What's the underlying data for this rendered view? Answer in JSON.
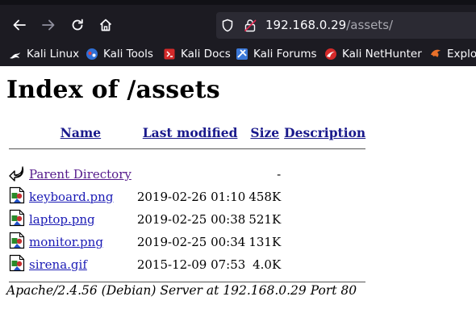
{
  "browser": {
    "url_host": "192.168.0.29",
    "url_path": "/assets/",
    "bookmarks": [
      {
        "label": "Kali Linux",
        "icon": "kali-dragon-icon"
      },
      {
        "label": "Kali Tools",
        "icon": "kali-tools-icon"
      },
      {
        "label": "Kali Docs",
        "icon": "kali-docs-icon"
      },
      {
        "label": "Kali Forums",
        "icon": "kali-forums-icon"
      },
      {
        "label": "Kali NetHunter",
        "icon": "kali-nethunter-icon"
      },
      {
        "label": "Exploit",
        "icon": "exploit-db-icon"
      }
    ]
  },
  "page": {
    "title": "Index of /assets",
    "columns": {
      "name": "Name",
      "last_modified": "Last modified",
      "size": "Size",
      "description": "Description"
    },
    "parent": {
      "name": "Parent Directory",
      "size": "-",
      "icon": "back-arrow-icon"
    },
    "files": [
      {
        "name": "keyboard.png",
        "modified": "2019-02-26 01:10",
        "size": "458K",
        "icon": "image-file-icon"
      },
      {
        "name": "laptop.png",
        "modified": "2019-02-25 00:38",
        "size": "521K",
        "icon": "image-file-icon"
      },
      {
        "name": "monitor.png",
        "modified": "2019-02-25 00:34",
        "size": "131K",
        "icon": "image-file-icon"
      },
      {
        "name": "sirena.gif",
        "modified": "2015-12-09 07:53",
        "size": "4.0K",
        "icon": "image-file-icon"
      }
    ],
    "footer": "Apache/2.4.56 (Debian) Server at 192.168.0.29 Port 80"
  },
  "colors": {
    "chrome_bg": "#1c1b22",
    "urlbar_bg": "#2b2a33",
    "link": "#1a1ab5",
    "visited_link": "#551a8b"
  }
}
